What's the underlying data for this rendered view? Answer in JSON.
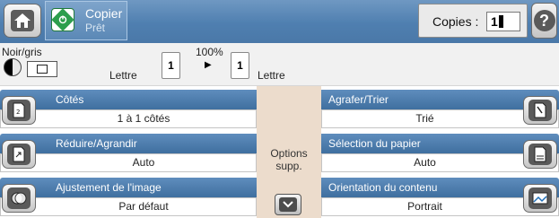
{
  "header": {
    "app_title": "Copier",
    "status": "Prêt",
    "copies_label": "Copies :",
    "copies_value": "1",
    "help_glyph": "?"
  },
  "strip": {
    "color_mode": "Noir/gris",
    "zoom": "100%",
    "source_paper": "Lettre",
    "source_count": "1",
    "target_count": "1",
    "target_paper": "Lettre"
  },
  "options_left": [
    {
      "label": "Côtés",
      "value": "1 à 1 côtés",
      "icon": "duplex-page-icon"
    },
    {
      "label": "Réduire/Agrandir",
      "value": "Auto",
      "icon": "resize-page-icon"
    },
    {
      "label": "Ajustement de l'image",
      "value": "Par défaut",
      "icon": "image-adjust-icon"
    }
  ],
  "options_right": [
    {
      "label": "Agrafer/Trier",
      "value": "Trié",
      "icon": "staple-icon"
    },
    {
      "label": "Sélection du papier",
      "value": "Auto",
      "icon": "paper-tray-icon"
    },
    {
      "label": "Orientation du contenu",
      "value": "Portrait",
      "icon": "orientation-icon"
    }
  ],
  "center": {
    "options_label_line1": "Options",
    "options_label_line2": "supp."
  },
  "colors": {
    "header_blue": "#4f7fb0",
    "option_header": "#4a7aab",
    "center_panel": "#ecdccc",
    "start_green": "#2d9e4d"
  }
}
